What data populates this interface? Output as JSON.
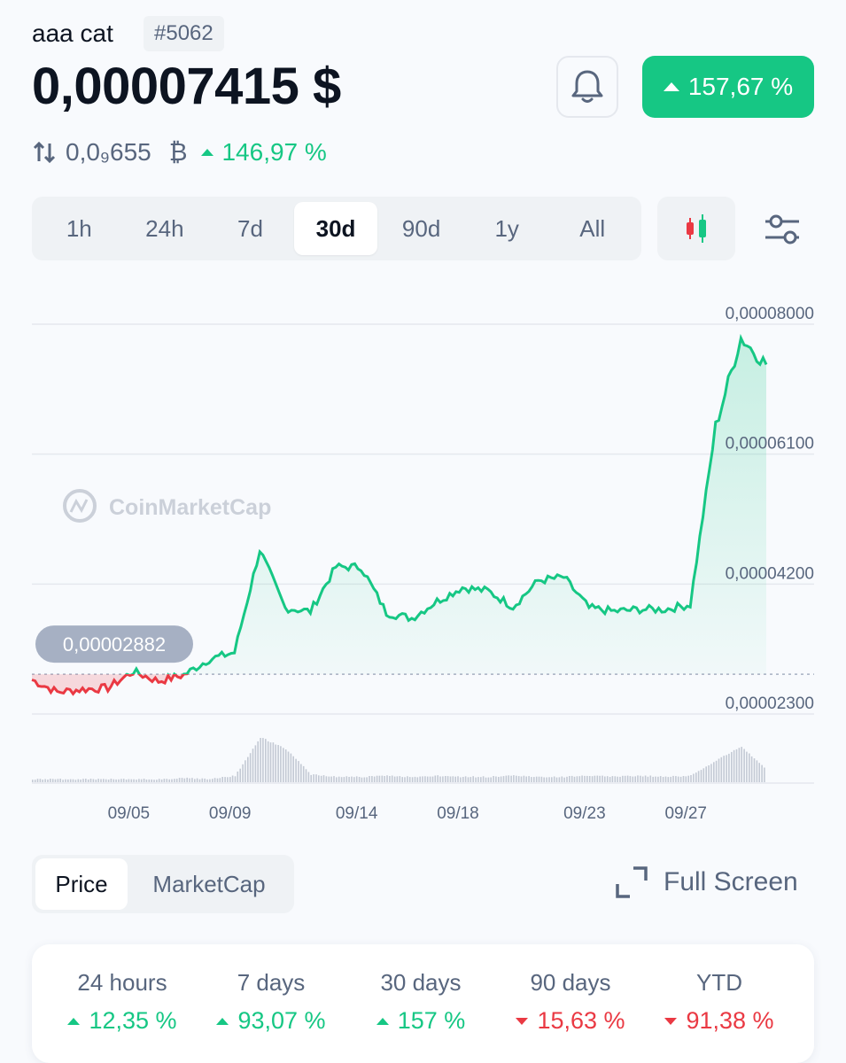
{
  "header": {
    "coin_name": "aaa cat",
    "rank": "#5062",
    "price": "0,00007415 $",
    "change_30d": "157,67 %",
    "btc_price": "0,0₉655",
    "btc_symbol": "₿",
    "btc_change": "146,97 %"
  },
  "ranges": {
    "items": [
      "1h",
      "24h",
      "7d",
      "30d",
      "90d",
      "1y",
      "All"
    ],
    "active": "30d"
  },
  "icons": [
    "swap-vertical-icon",
    "bell-icon",
    "candlestick-icon",
    "sliders-icon",
    "fullscreen-icon",
    "caret-up-icon",
    "caret-down-icon"
  ],
  "watermark": "CoinMarketCap",
  "colors": {
    "up": "#16c784",
    "down": "#ea3943",
    "muted": "#58667e",
    "text": "#0d1421"
  },
  "chart_data": {
    "type": "area",
    "y_ticks": [
      "0,00008000",
      "0,00006100",
      "0,00004200",
      "0,00002300"
    ],
    "x_ticks": [
      "09/05",
      "09/09",
      "09/14",
      "09/18",
      "09/23",
      "09/27"
    ],
    "baseline_label": "0,00002882",
    "baseline_value": 2.882e-05,
    "ylim": [
      2.3e-05,
      8e-05
    ],
    "grid": true,
    "x": [
      "09/01",
      "09/02",
      "09/03",
      "09/04",
      "09/05",
      "09/06",
      "09/07",
      "09/08",
      "09/09",
      "09/10",
      "09/11",
      "09/12",
      "09/13",
      "09/14",
      "09/15",
      "09/16",
      "09/17",
      "09/18",
      "09/19",
      "09/20",
      "09/21",
      "09/22",
      "09/23",
      "09/24",
      "09/25",
      "09/26",
      "09/27",
      "09/28",
      "09/29",
      "09/30"
    ],
    "series": [
      {
        "values": [
          2.8e-05,
          2.62e-05,
          2.66e-05,
          2.68e-05,
          2.92e-05,
          2.78e-05,
          2.87e-05,
          3.1e-05,
          3.2e-05,
          4.7e-05,
          3.85e-05,
          3.8e-05,
          4.45e-05,
          4.45e-05,
          3.78e-05,
          3.7e-05,
          3.95e-05,
          4.15e-05,
          4.1e-05,
          3.87e-05,
          4.25e-05,
          4.3e-05,
          3.85e-05,
          3.8e-05,
          3.83e-05,
          3.83e-05,
          3.9e-05,
          6.5e-05,
          7.8e-05,
          7.41e-05
        ]
      }
    ]
  },
  "volume_values": [
    2,
    2,
    2,
    2,
    2,
    2,
    3,
    2,
    5,
    38,
    28,
    6,
    4,
    4,
    5,
    4,
    5,
    4,
    4,
    5,
    4,
    4,
    5,
    4,
    5,
    4,
    5,
    18,
    30,
    10
  ],
  "bottom": {
    "price_tab": "Price",
    "marketcap_tab": "MarketCap",
    "fullscreen": "Full Screen"
  },
  "stats": [
    {
      "label": "24 hours",
      "value": "12,35 %",
      "dir": "up"
    },
    {
      "label": "7 days",
      "value": "93,07 %",
      "dir": "up"
    },
    {
      "label": "30 days",
      "value": "157 %",
      "dir": "up"
    },
    {
      "label": "90 days",
      "value": "15,63 %",
      "dir": "down"
    },
    {
      "label": "YTD",
      "value": "91,38 %",
      "dir": "down"
    }
  ]
}
